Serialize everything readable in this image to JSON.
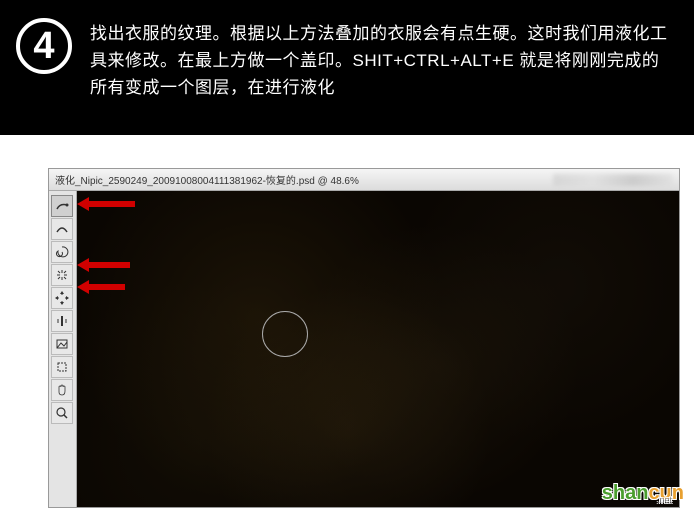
{
  "step": {
    "number": "4",
    "text": "找出衣服的纹理。根据以上方法叠加的衣服会有点生硬。这时我们用液化工具来修改。在最上方做一个盖印。SHIT+CTRL+ALT+E 就是将刚刚完成的所有变成一个图层，在进行液化"
  },
  "window": {
    "title": "液化_Nipic_2590249_20091008004111381962-恢复的.psd @ 48.6%"
  },
  "tools": {
    "forward_warp": "〰",
    "reconstruct": "↻",
    "twirl": "◉",
    "pucker": "✱",
    "bloat": "◈",
    "push_left": "◨",
    "mirror": "▣",
    "turbulence": "⬚",
    "freeze": "✋",
    "thaw": "🔍"
  },
  "watermark": {
    "text1": "shan",
    "text2": "cun",
    "sub": ".net"
  }
}
